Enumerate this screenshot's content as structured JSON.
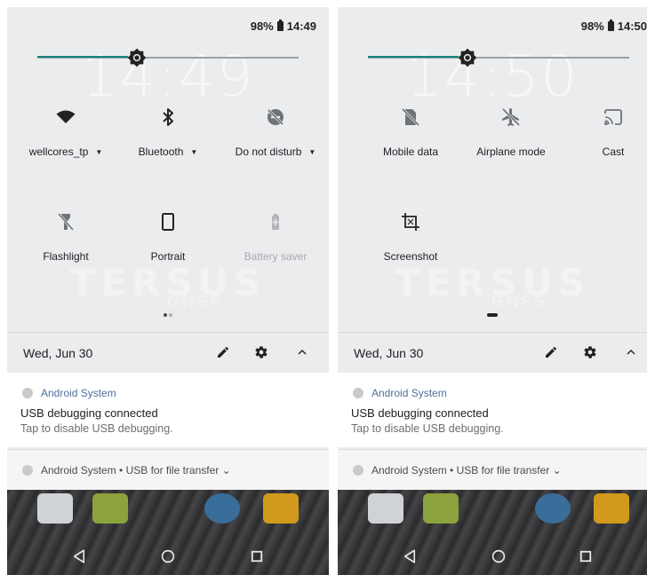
{
  "left": {
    "status": {
      "battery": "98%",
      "time": "14:49"
    },
    "background_clock": "14:49",
    "brightness": 0.38,
    "tiles": [
      {
        "label": "wellcores_tp",
        "dropdown": true,
        "icon": "wifi-icon"
      },
      {
        "label": "Bluetooth",
        "dropdown": true,
        "icon": "bluetooth-icon"
      },
      {
        "label": "Do not disturb",
        "dropdown": true,
        "icon": "dnd-off-icon"
      },
      {
        "label": "Flashlight",
        "icon": "flashlight-off-icon"
      },
      {
        "label": "Portrait",
        "icon": "portrait-icon"
      },
      {
        "label": "Battery saver",
        "icon": "battery-saver-icon",
        "disabled": true
      }
    ],
    "page_indicator": "page 1 of 2"
  },
  "right": {
    "status": {
      "battery": "98%",
      "time": "14:50"
    },
    "background_clock": "14:50",
    "brightness": 0.38,
    "tiles": [
      {
        "label": "Mobile data",
        "icon": "mobile-data-off-icon"
      },
      {
        "label": "Airplane mode",
        "icon": "airplane-off-icon"
      },
      {
        "label": "Cast",
        "icon": "cast-icon"
      },
      {
        "label": "Screenshot",
        "icon": "screenshot-icon"
      }
    ],
    "page_indicator": "page 2 of 2"
  },
  "date": "Wed, Jun 30",
  "watermark": {
    "main": "TERSUS",
    "sub": "GNSS"
  },
  "notification": {
    "app": "Android System",
    "title": "USB debugging connected",
    "text": "Tap to disable USB debugging."
  },
  "notification2": {
    "line": "Android System • USB for file transfer ⌄"
  },
  "colors": {
    "accent": "#14857b",
    "panel_bg": "#ebecee",
    "app_name": "#4f6f9a"
  }
}
